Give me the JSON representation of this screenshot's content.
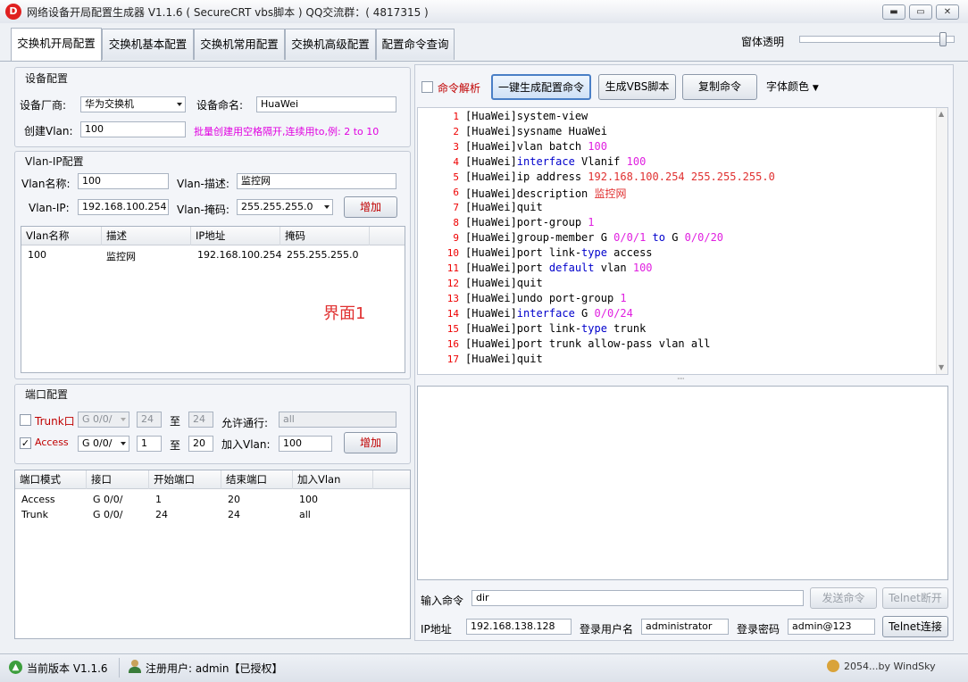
{
  "window": {
    "title": "网络设备开局配置生成器  V1.1.6 ( SecureCRT vbs脚本 )  QQ交流群：( 4817315 )",
    "logo": "D",
    "min_icon": "minimize-icon",
    "max_icon": "maximize-icon",
    "close_icon": "close-icon"
  },
  "tabs": [
    {
      "label": "交换机开局配置"
    },
    {
      "label": "交换机基本配置"
    },
    {
      "label": "交换机常用配置"
    },
    {
      "label": "交换机高级配置"
    },
    {
      "label": "配置命令查询"
    }
  ],
  "transparency": {
    "label": "窗体透明",
    "value": 0.95
  },
  "device": {
    "group_title": "设备配置",
    "vendor_label": "设备厂商:",
    "vendor_value": "华为交换机",
    "name_label": "设备命名:",
    "name_value": "HuaWei",
    "vlan_label": "创建Vlan:",
    "vlan_value": "100",
    "hint": "批量创建用空格隔开,连续用to,例: 2 to 10"
  },
  "vlanip": {
    "group_title": "Vlan-IP配置",
    "name_label": "Vlan名称:",
    "name_value": "100",
    "desc_label": "Vlan-描述:",
    "desc_value": "监控网",
    "ip_label": "Vlan-IP:",
    "ip_value": "192.168.100.254",
    "mask_label": "Vlan-掩码:",
    "mask_value": "255.255.255.0",
    "add_label": "增加",
    "columns": [
      "Vlan名称",
      "描述",
      "IP地址",
      "掩码"
    ],
    "rows": [
      [
        "100",
        "监控网",
        "192.168.100.254",
        "255.255.255.0"
      ]
    ],
    "watermark": "界面1"
  },
  "port": {
    "group_title": "端口配置",
    "trunk_label": "Trunk口",
    "trunk_checked": false,
    "trunk_iface": "G 0/0/",
    "trunk_start": "24",
    "to1": "至",
    "trunk_end": "24",
    "allow_label": "允许通行:",
    "allow_value": "all",
    "access_label": "Access",
    "access_checked": true,
    "access_iface": "G 0/0/",
    "access_start": "1",
    "to2": "至",
    "access_end": "20",
    "join_label": "加入Vlan:",
    "join_value": "100",
    "add_label": "增加",
    "check_mark": "✓"
  },
  "portgrid": {
    "columns": [
      "端口模式",
      "接口",
      "开始端口",
      "结束端口",
      "加入Vlan"
    ],
    "rows": [
      [
        "Access",
        "G 0/0/",
        "1",
        "20",
        "100"
      ],
      [
        "Trunk",
        "G 0/0/",
        "24",
        "24",
        "all"
      ]
    ]
  },
  "toolbar": {
    "parse_label": "命令解析",
    "gen_label": "一键生成配置命令",
    "vbs_label": "生成VBS脚本",
    "copy_label": "复制命令",
    "font_color_label": "字体颜色"
  },
  "code_lines": [
    [
      [
        "[HuaWei]",
        ""
      ],
      [
        "system-view",
        ""
      ]
    ],
    [
      [
        "[HuaWei]",
        ""
      ],
      [
        "sysname HuaWei",
        ""
      ]
    ],
    [
      [
        "[HuaWei]",
        ""
      ],
      [
        "vlan batch ",
        ""
      ],
      [
        "100",
        "n"
      ]
    ],
    [
      [
        "[HuaWei]",
        ""
      ],
      [
        "interface",
        "k"
      ],
      [
        " Vlanif ",
        ""
      ],
      [
        "100",
        "n"
      ]
    ],
    [
      [
        "[HuaWei]",
        ""
      ],
      [
        "ip address ",
        ""
      ],
      [
        "192.168.100.254 255.255.255.0",
        "r"
      ]
    ],
    [
      [
        "[HuaWei]",
        ""
      ],
      [
        "description ",
        ""
      ],
      [
        "监控网",
        "cn"
      ]
    ],
    [
      [
        "[HuaWei]",
        ""
      ],
      [
        "quit",
        ""
      ]
    ],
    [
      [
        "[HuaWei]",
        ""
      ],
      [
        "port-group ",
        ""
      ],
      [
        "1",
        "n"
      ]
    ],
    [
      [
        "[HuaWei]",
        ""
      ],
      [
        "group-member G ",
        ""
      ],
      [
        "0/0/1",
        "n"
      ],
      [
        " ",
        ""
      ],
      [
        "to",
        "k"
      ],
      [
        " G ",
        ""
      ],
      [
        "0/0/20",
        "n"
      ]
    ],
    [
      [
        "[HuaWei]",
        ""
      ],
      [
        "port link-",
        ""
      ],
      [
        "type",
        "k"
      ],
      [
        " access",
        ""
      ]
    ],
    [
      [
        "[HuaWei]",
        ""
      ],
      [
        "port ",
        ""
      ],
      [
        "default",
        "k"
      ],
      [
        " vlan ",
        ""
      ],
      [
        "100",
        "n"
      ]
    ],
    [
      [
        "[HuaWei]",
        ""
      ],
      [
        "quit",
        ""
      ]
    ],
    [
      [
        "[HuaWei]",
        ""
      ],
      [
        "undo port-group ",
        ""
      ],
      [
        "1",
        "n"
      ]
    ],
    [
      [
        "[HuaWei]",
        ""
      ],
      [
        "interface",
        "k"
      ],
      [
        " G ",
        ""
      ],
      [
        "0/0/24",
        "n"
      ]
    ],
    [
      [
        "[HuaWei]",
        ""
      ],
      [
        "port link-",
        ""
      ],
      [
        "type",
        "k"
      ],
      [
        " trunk",
        ""
      ]
    ],
    [
      [
        "[HuaWei]",
        ""
      ],
      [
        "port trunk allow-pass vlan all",
        ""
      ]
    ],
    [
      [
        "[HuaWei]",
        ""
      ],
      [
        "quit",
        ""
      ]
    ]
  ],
  "console": {
    "input_label": "输入命令",
    "input_value": "dir",
    "send_label": "发送命令",
    "telnet_disconnect_label": "Telnet断开",
    "ip_label": "IP地址",
    "ip_value": "192.168.138.128",
    "user_label": "登录用户名",
    "user_value": "administrator",
    "pwd_label": "登录密码",
    "pwd_value": "admin@123",
    "telnet_connect_label": "Telnet连接"
  },
  "status": {
    "version_text": "当前版本 V1.1.6",
    "user_text": "注册用户: admin【已授权】",
    "author_text": "2054...by WindSky"
  }
}
